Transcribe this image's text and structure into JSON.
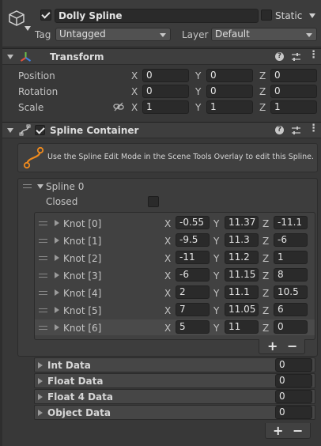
{
  "object": {
    "name": "Dolly Spline",
    "static_label": "Static",
    "tag_label": "Tag",
    "tag_value": "Untagged",
    "layer_label": "Layer",
    "layer_value": "Default"
  },
  "transform": {
    "title": "Transform",
    "rows": [
      {
        "label": "Position",
        "x": "0",
        "y": "0",
        "z": "0"
      },
      {
        "label": "Rotation",
        "x": "0",
        "y": "0",
        "z": "0"
      },
      {
        "label": "Scale",
        "x": "1",
        "y": "1",
        "z": "1"
      }
    ]
  },
  "axes": {
    "x": "X",
    "y": "Y",
    "z": "Z"
  },
  "spline_container": {
    "title": "Spline Container",
    "info": "Use the Spline Edit Mode in the Scene Tools Overlay to edit this Spline.",
    "spline_label": "Spline 0",
    "closed_label": "Closed",
    "knots": [
      {
        "label": "Knot [0]",
        "x": "-0.55",
        "y": "11.37",
        "z": "-11.1"
      },
      {
        "label": "Knot [1]",
        "x": "-9.5",
        "y": "11.3",
        "z": "-6"
      },
      {
        "label": "Knot [2]",
        "x": "-11",
        "y": "11.2",
        "z": "1"
      },
      {
        "label": "Knot [3]",
        "x": "-6",
        "y": "11.15",
        "z": "8"
      },
      {
        "label": "Knot [4]",
        "x": "2",
        "y": "11.1",
        "z": "10.5"
      },
      {
        "label": "Knot [5]",
        "x": "7",
        "y": "11.05",
        "z": "6"
      },
      {
        "label": "Knot [6]",
        "x": "5",
        "y": "11",
        "z": "0"
      }
    ],
    "data_sections": [
      {
        "label": "Int Data",
        "value": "0"
      },
      {
        "label": "Float Data",
        "value": "0"
      },
      {
        "label": "Float 4 Data",
        "value": "0"
      },
      {
        "label": "Object Data",
        "value": "0"
      }
    ]
  },
  "buttons": {
    "add": "+",
    "remove": "−"
  }
}
